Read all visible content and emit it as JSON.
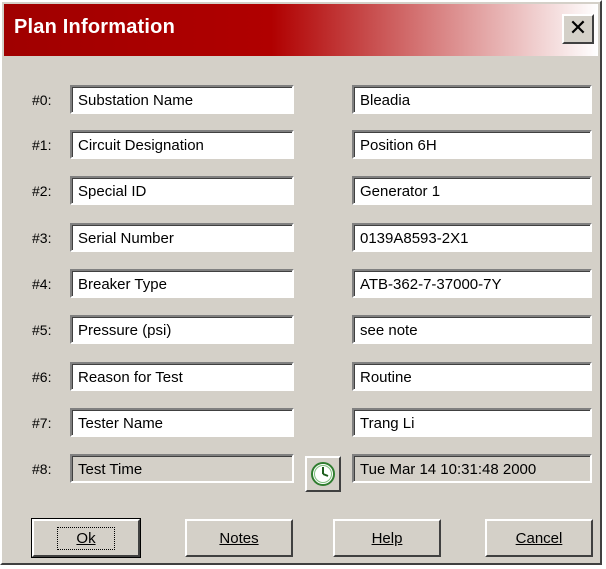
{
  "dialog": {
    "title": "Plan Information",
    "close_label": "✕"
  },
  "rows": [
    {
      "index": "#0:",
      "label": "Substation Name",
      "value": "Bleadia"
    },
    {
      "index": "#1:",
      "label": "Circuit Designation",
      "value": "Position 6H"
    },
    {
      "index": "#2:",
      "label": "Special ID",
      "value": "Generator 1"
    },
    {
      "index": "#3:",
      "label": "Serial Number",
      "value": "0139A8593-2X1"
    },
    {
      "index": "#4:",
      "label": "Breaker Type",
      "value": "ATB-362-7-37000-7Y"
    },
    {
      "index": "#5:",
      "label": "Pressure (psi)",
      "value": "see note"
    },
    {
      "index": "#6:",
      "label": "Reason for Test",
      "value": "Routine"
    },
    {
      "index": "#7:",
      "label": "Tester Name",
      "value": "Trang Li"
    },
    {
      "index": "#8:",
      "label": "Test Time",
      "value": "Tue Mar 14 10:31:48 2000"
    }
  ],
  "clock_icon": "clock-icon",
  "buttons": {
    "ok": "Ok",
    "notes": "Notes",
    "help": "Help",
    "cancel": "Cancel"
  }
}
